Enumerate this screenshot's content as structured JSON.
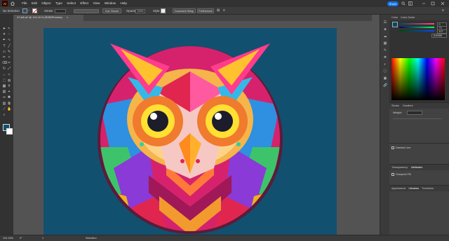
{
  "app": {
    "logo_text": "Ai"
  },
  "menu": {
    "items": [
      "File",
      "Edit",
      "Object",
      "Type",
      "Select",
      "Effect",
      "View",
      "Window",
      "Help"
    ]
  },
  "share_label": "Share",
  "control_bar": {
    "selection_label": "No Selection",
    "stroke_label": "Stroke:",
    "brush_value": "5 pt. Round",
    "opacity_label": "Opacity:",
    "opacity_value": "100%",
    "style_label": "Style:",
    "doc_setup_label": "Document Setup",
    "preferences_label": "Preferences",
    "fill_color": "#2a4f6e"
  },
  "document_tab": {
    "title": "47-fa5.ai* @ 104.16 % (RGB/Preview)",
    "close": "×"
  },
  "panels": {
    "color_tab": "Color",
    "color_guide_tab": "Color Guide",
    "properties_tab": "Properties",
    "layers_tab": "Layers",
    "stroke_tab": "Stroke",
    "gradient_tab": "Gradient",
    "weight_label": "Weight:",
    "dashed_line_label": "Dashed Line",
    "transparency_tab": "Transparency",
    "attributes_tab": "Attributes",
    "overprint_fill_label": "Overprint Fill",
    "appearance_tab": "Appearance",
    "libraries_tab": "Libraries",
    "transform_tab": "Transform",
    "color_hex": "00496B",
    "channels": [
      "0",
      "73",
      "107"
    ]
  },
  "status": {
    "zoom": "104.16%",
    "angle": "0°",
    "page": "1",
    "tool": "Selection"
  }
}
